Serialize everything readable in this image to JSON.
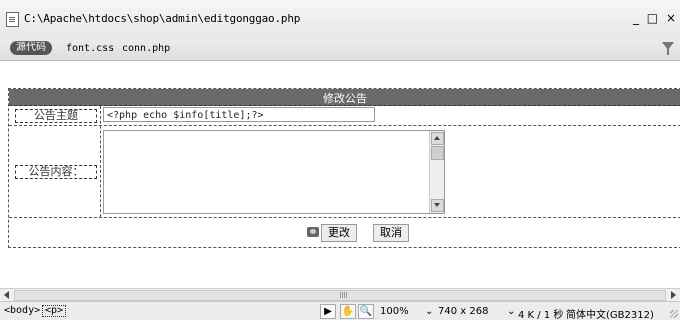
{
  "window": {
    "title": "C:\\Apache\\htdocs\\shop\\admin\\editgonggao.php",
    "controls": [
      "_",
      "□",
      "×"
    ]
  },
  "toolbar": {
    "source_label": "源代码",
    "related_files": [
      "font.css",
      "conn.php"
    ],
    "filter_icon": "filter-icon"
  },
  "form": {
    "header": "修改公告",
    "title_label": "公告主题",
    "title_value": "<?php echo $info[title];?>",
    "content_label": "公告内容：",
    "submit_label": "更改",
    "cancel_label": "取消"
  },
  "statusbar": {
    "tags": [
      "<body>",
      "<p>"
    ],
    "zoom": "100%",
    "window_size": "740 x 268",
    "doc_size": "4 K / 1 秒",
    "encoding": "简体中文(GB2312)"
  }
}
